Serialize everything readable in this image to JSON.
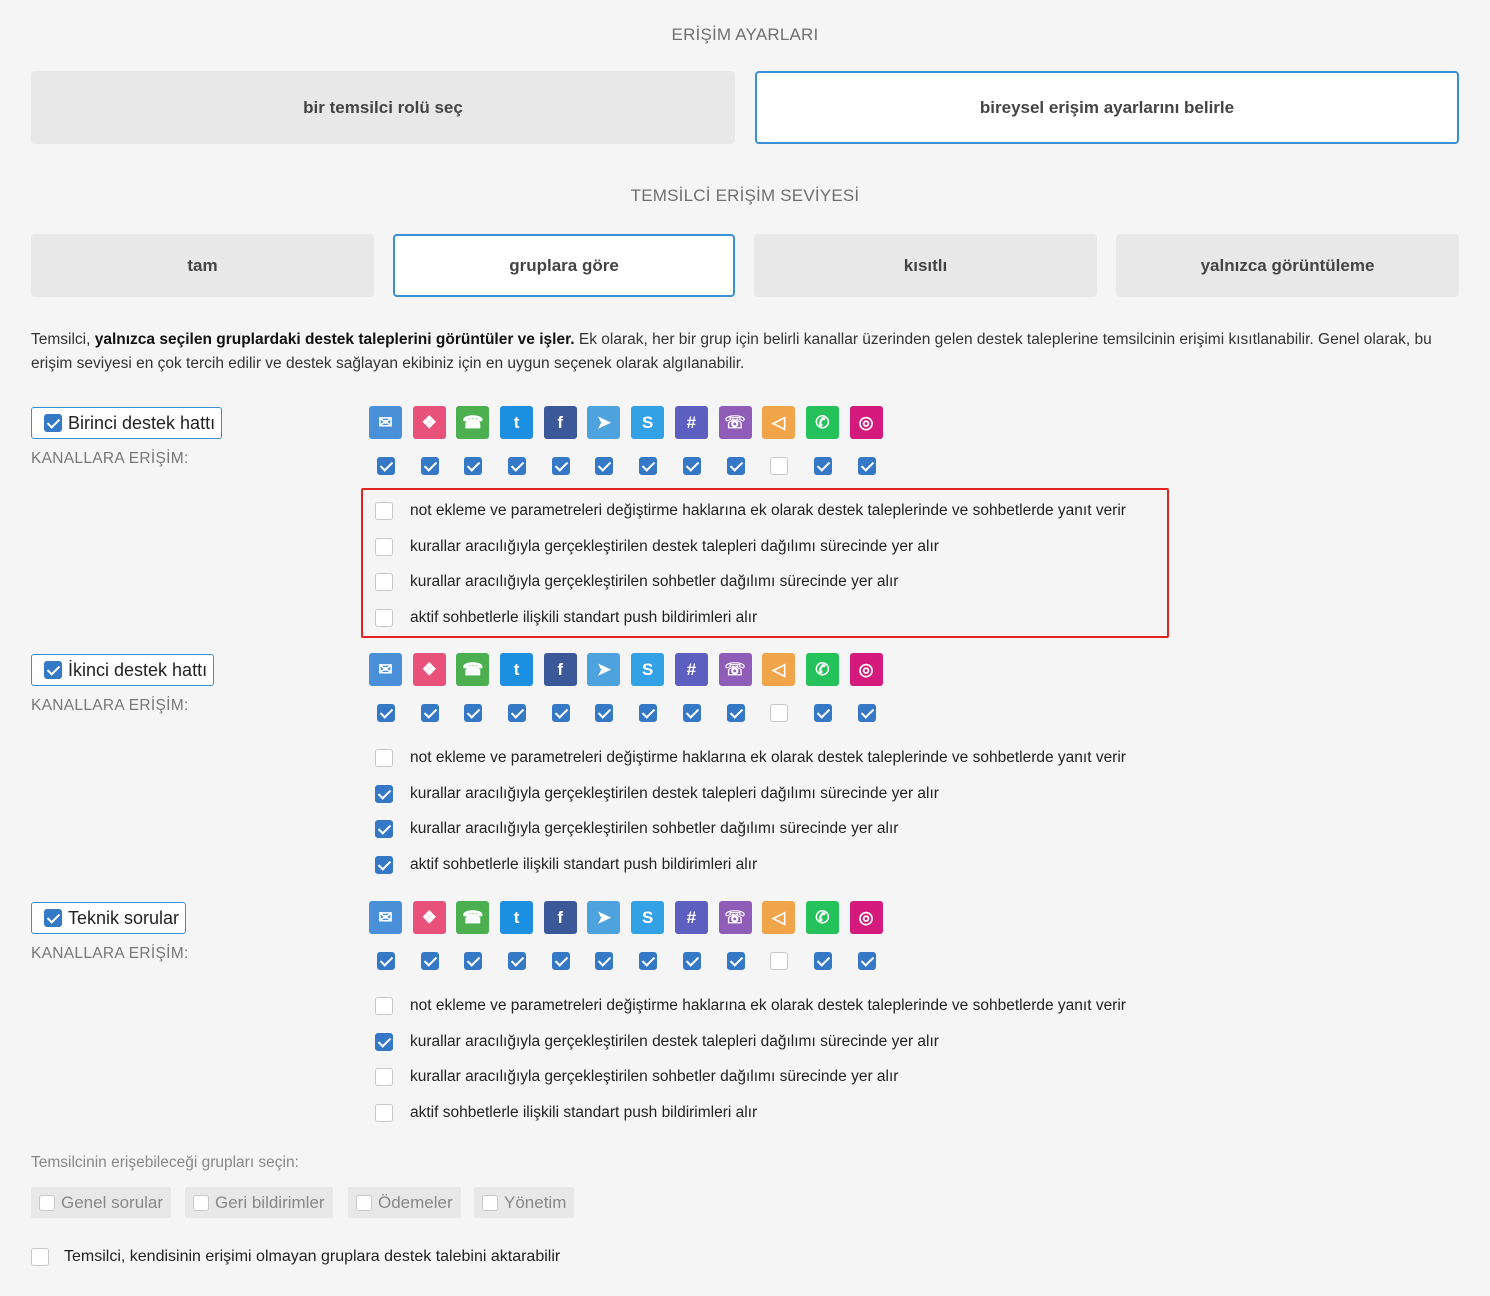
{
  "access_settings": {
    "title": "ERİŞİM AYARLARI",
    "role_button": "bir temsilci rolü seç",
    "individual_button": "bireysel erişim ayarlarını belirle"
  },
  "access_level": {
    "title": "TEMSİLCİ ERİŞİM SEVİYESİ",
    "options": [
      "tam",
      "gruplara göre",
      "kısıtlı",
      "yalnızca görüntüleme"
    ],
    "selected": "gruplara göre"
  },
  "description": {
    "prefix": "Temsilci, ",
    "bold": "yalnızca seçilen gruplardaki destek taleplerini görüntüler ve işler.",
    "rest": " Ek olarak, her bir grup için belirli kanallar üzerinden gelen destek taleplerine temsilcinin erişimi kısıtlanabilir. Genel olarak, bu erişim seviyesi en çok tercih edilir ve destek sağlayan ekibiniz için en uygun seçenek olarak algılanabilir."
  },
  "channel_access_label": "KANALLARA ERİŞİM:",
  "channels": [
    {
      "name": "email-icon",
      "color": "#4a90d9"
    },
    {
      "name": "chat-icon",
      "color": "#e8527a"
    },
    {
      "name": "phone-icon",
      "color": "#4caf50"
    },
    {
      "name": "twitter-icon",
      "color": "#1d8fe0"
    },
    {
      "name": "facebook-icon",
      "color": "#3b5998"
    },
    {
      "name": "telegram-icon",
      "color": "#4ea3de"
    },
    {
      "name": "skype-icon",
      "color": "#32a1e6"
    },
    {
      "name": "slack-icon",
      "color": "#5c5fbf"
    },
    {
      "name": "viber-icon",
      "color": "#8f5db7"
    },
    {
      "name": "megaphone-icon",
      "color": "#f0a54a"
    },
    {
      "name": "whatsapp-icon",
      "color": "#25c15a"
    },
    {
      "name": "instagram-icon",
      "color": "#d41a7c"
    }
  ],
  "permission_labels": [
    "not ekleme ve parametreleri değiştirme haklarına ek olarak destek taleplerinde ve sohbetlerde yanıt verir",
    "kurallar aracılığıyla gerçekleştirilen destek talepleri dağılımı sürecinde yer alır",
    "kurallar aracılığıyla gerçekleştirilen sohbetler dağılımı sürecinde yer alır",
    "aktif sohbetlerle ilişkili standart push bildirimleri alır"
  ],
  "groups": [
    {
      "name": "Birinci destek hattı",
      "checked": true,
      "channels_enabled": [
        true,
        true,
        true,
        true,
        true,
        true,
        true,
        true,
        true,
        false,
        true,
        true
      ],
      "permissions": [
        false,
        false,
        false,
        false
      ]
    },
    {
      "name": "İkinci destek hattı",
      "checked": true,
      "channels_enabled": [
        true,
        true,
        true,
        true,
        true,
        true,
        true,
        true,
        true,
        false,
        true,
        true
      ],
      "permissions": [
        false,
        true,
        true,
        true
      ]
    },
    {
      "name": "Teknik sorular",
      "checked": true,
      "channels_enabled": [
        true,
        true,
        true,
        true,
        true,
        true,
        true,
        true,
        true,
        false,
        true,
        true
      ],
      "permissions": [
        false,
        true,
        false,
        false
      ]
    }
  ],
  "select_groups": {
    "label": "Temsilcinin erişebileceği grupları seçin:",
    "options": [
      "Genel sorular",
      "Geri bildirimler",
      "Ödemeler",
      "Yönetim"
    ]
  },
  "transfer_option": "Temsilci, kendisinin erişimi olmayan gruplara destek talebini aktarabilir"
}
